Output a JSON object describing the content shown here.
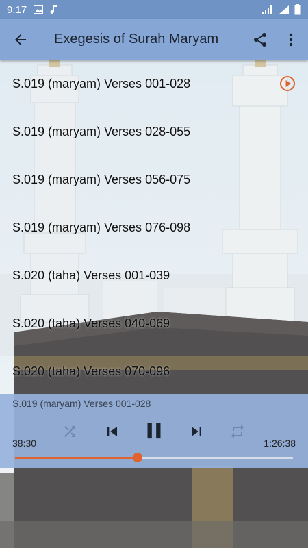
{
  "status_bar": {
    "time": "9:17"
  },
  "app_bar": {
    "title": "Exegesis of Surah Maryam"
  },
  "tracks": [
    {
      "label": "S.019 (maryam) Verses 001-028",
      "playing": true
    },
    {
      "label": "S.019 (maryam) Verses 028-055",
      "playing": false
    },
    {
      "label": "S.019 (maryam) Verses 056-075",
      "playing": false
    },
    {
      "label": "S.019 (maryam) Verses 076-098",
      "playing": false
    },
    {
      "label": "S.020 (taha) Verses 001-039",
      "playing": false
    },
    {
      "label": "S.020 (taha) Verses 040-069",
      "playing": false
    },
    {
      "label": "S.020 (taha) Verses 070-096",
      "playing": false
    }
  ],
  "player": {
    "now_playing": "S.019 (maryam) Verses 001-028",
    "elapsed": "38:30",
    "duration": "1:26:38",
    "progress": 0.44
  },
  "colors": {
    "status_bar": "#6f93c4",
    "app_bar": "#86a6d6",
    "accent": "#e0622f",
    "player_bg": "#96b2dc"
  }
}
